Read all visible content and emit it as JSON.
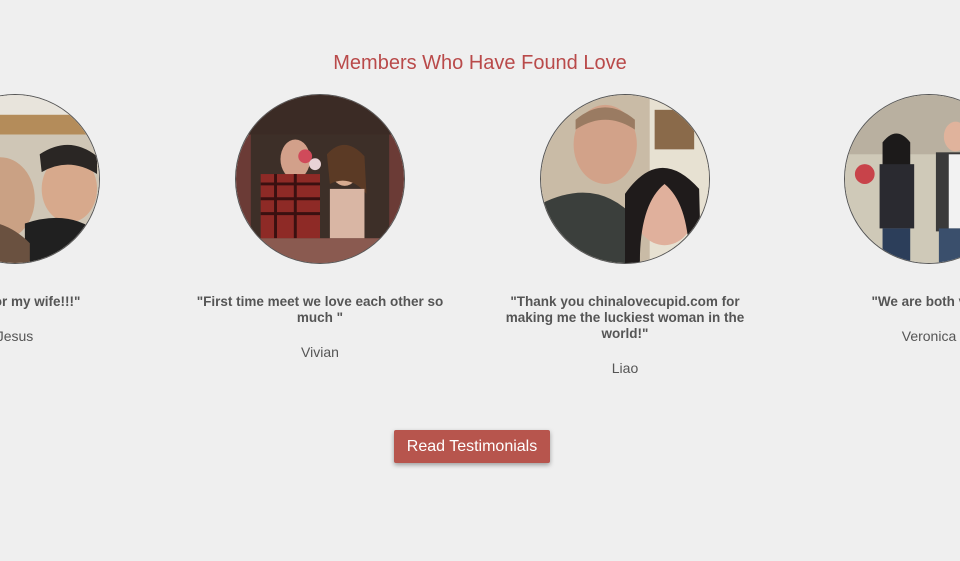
{
  "section": {
    "title": "Members Who Have Found Love"
  },
  "testimonials": [
    {
      "quote": "much for my wife!!!\"",
      "name": "Jesus",
      "photo_icon": "couple-photo"
    },
    {
      "quote": "\"First time meet we love each other so much \"",
      "name": "Vivian",
      "photo_icon": "couple-photo"
    },
    {
      "quote": "\"Thank you chinalovecupid.com for making me the luckiest woman in the world!\"",
      "name": "Liao",
      "photo_icon": "couple-photo"
    },
    {
      "quote": "\"We are both very",
      "name": "Veronica",
      "photo_icon": "couple-photo"
    }
  ],
  "cta": {
    "label": "Read Testimonials"
  },
  "colors": {
    "background": "#efefef",
    "title": "#b94a4a",
    "button": "#b7554d",
    "text": "#555555"
  }
}
